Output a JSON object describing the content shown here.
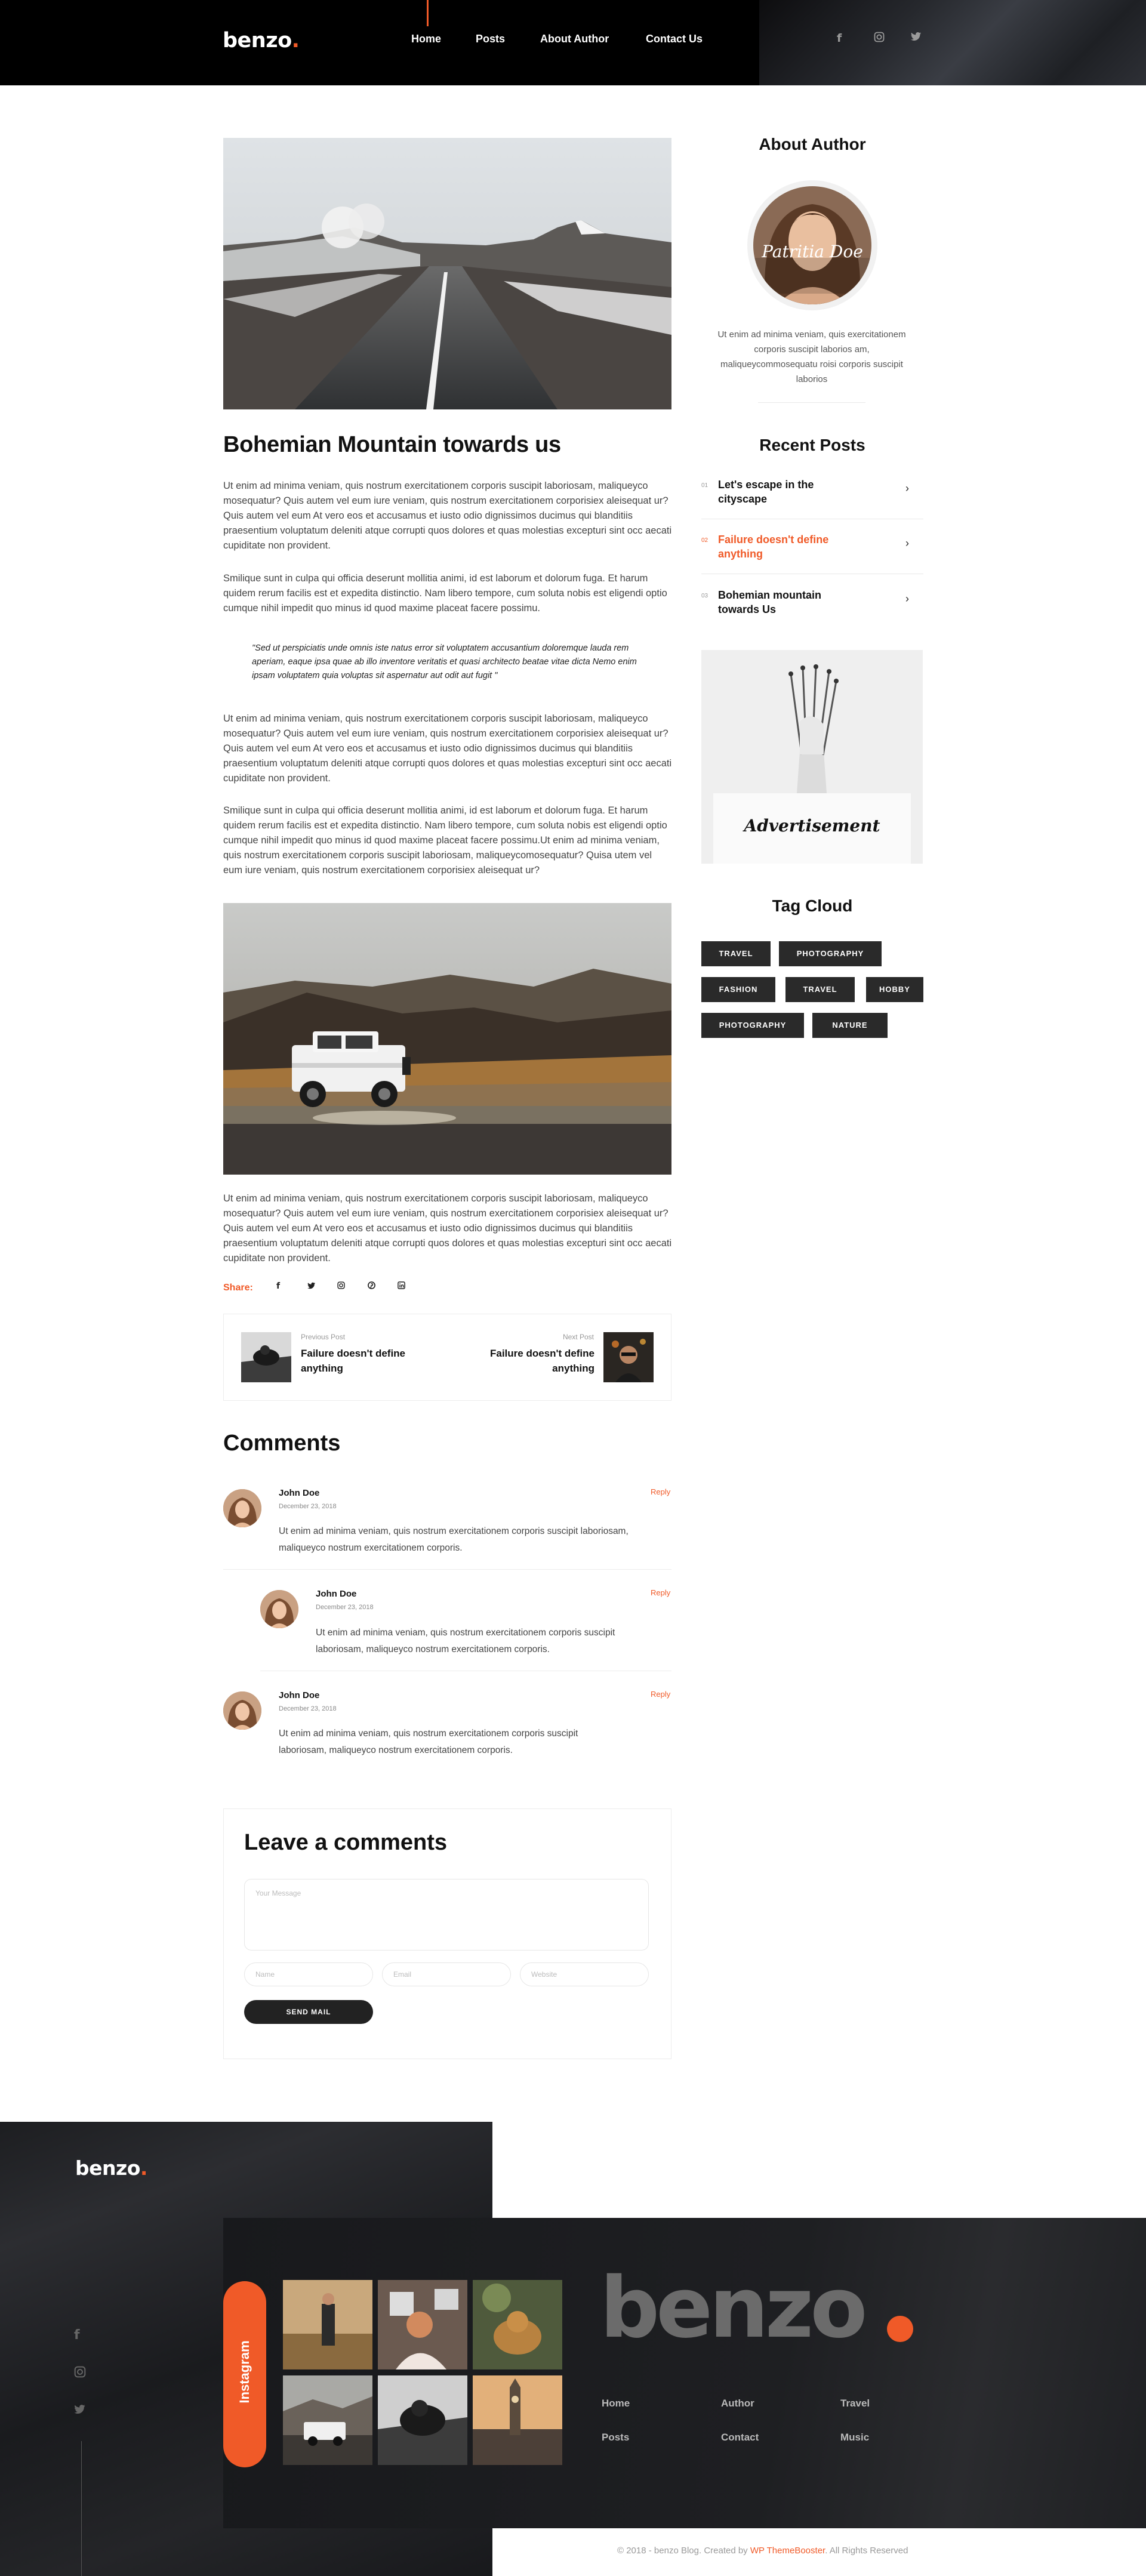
{
  "header": {
    "logo": "benzo",
    "nav": [
      "Home",
      "Posts",
      "About Author",
      "Contact Us"
    ],
    "social_icons": [
      "facebook-icon",
      "instagram-icon",
      "twitter-icon"
    ]
  },
  "post": {
    "title": "Bohemian Mountain towards us",
    "p1": "Ut enim ad minima veniam, quis nostrum exercitationem corporis suscipit laboriosam, maliqueyco mosequatur? Quis autem vel eum iure veniam, quis nostrum exercitationem corporisiex aleisequat ur? Quis autem vel eum At vero eos et accusamus et iusto odio dignissimos ducimus qui blanditiis  praesentium voluptatum deleniti atque corrupti quos dolores et quas molestias excepturi sint occ aecati cupiditate non provident.",
    "p2": "Smilique sunt in culpa qui officia deserunt mollitia animi, id est laborum et dolorum fuga. Et harum  quidem rerum facilis est et expedita distinctio. Nam libero tempore, cum soluta nobis est eligendi optio cumque nihil impedit quo minus id quod maxime placeat facere possimu.",
    "quote": "\"Sed ut perspiciatis unde omnis iste natus error sit voluptatem accusantium doloremque lauda rem aperiam, eaque ipsa quae ab illo inventore veritatis et quasi architecto beatae vitae dicta Nemo enim ipsam voluptatem quia voluptas sit aspernatur aut odit aut fugit \"",
    "p3": "Ut enim ad minima veniam, quis nostrum exercitationem corporis suscipit laboriosam, maliqueyco mosequatur? Quis autem vel eum iure veniam, quis nostrum exercitationem corporisiex aleisequat ur? Quis autem vel eum At vero eos et accusamus et iusto odio dignissimos ducimus qui blanditiis  praesentium voluptatum deleniti atque corrupti quos dolores et quas molestias excepturi sint occ aecati cupiditate non provident.",
    "p4": "Smilique sunt in culpa qui officia deserunt mollitia animi, id est laborum et dolorum fuga. Et harum  quidem rerum facilis est et expedita distinctio. Nam libero tempore, cum soluta nobis est eligendi optio cumque nihil impedit quo minus id quod maxime placeat facere possimu.Ut enim ad minima veniam, quis nostrum exercitationem corporis suscipit laboriosam, maliqueycomosequatur? Quisa utem vel eum iure veniam, quis nostrum exercitationem corporisiex aleisequat ur?",
    "p5": "Ut enim ad minima veniam, quis nostrum exercitationem corporis suscipit laboriosam, maliqueyco mosequatur? Quis autem vel eum iure veniam, quis nostrum exercitationem corporisiex aleisequat ur? Quis autem vel eum At vero eos et accusamus et iusto odio dignissimos ducimus qui blanditiis  praesentium voluptatum deleniti atque corrupti quos dolores et quas molestias excepturi sint occ aecati cupiditate non provident.",
    "share_label": "Share:",
    "share_icons": [
      "facebook-icon",
      "twitter-icon",
      "instagram-icon",
      "pinterest-icon",
      "linkedin-icon"
    ]
  },
  "post_nav": {
    "prev_label": "Previous Post",
    "prev_title": "Failure doesn't define anything",
    "next_label": "Next Post",
    "next_title": "Failure doesn't define anything"
  },
  "comments": {
    "heading": "Comments",
    "items": [
      {
        "name": "John Doe",
        "date": "December 23, 2018",
        "reply": "Reply",
        "text": "Ut enim ad minima veniam, quis nostrum exercitationem corporis suscipit laboriosam, maliqueyco nostrum exercitationem corporis."
      },
      {
        "name": "John Doe",
        "date": "December 23, 2018",
        "reply": "Reply",
        "text": "Ut enim ad minima veniam, quis nostrum exercitationem corporis suscipit laboriosam, maliqueyco nostrum exercitationem corporis."
      },
      {
        "name": "John Doe",
        "date": "December 23, 2018",
        "reply": "Reply",
        "text": "Ut enim ad minima veniam, quis nostrum exercitationem corporis suscipit laboriosam, maliqueyco nostrum exercitationem corporis."
      }
    ]
  },
  "leave": {
    "heading": "Leave a comments",
    "message_placeholder": "Your Message",
    "name_placeholder": "Name",
    "email_placeholder": "Email",
    "website_placeholder": "Website",
    "send": "SEND MAIL"
  },
  "sidebar": {
    "about_heading": "About Author",
    "author_signature": "Patritia Doe",
    "about_text": "Ut enim ad minima veniam, quis exercitationem corporis suscipit laborios am, maliqueycommosequatu roisi corporis suscipit laborios",
    "recent_heading": "Recent Posts",
    "recent": [
      {
        "num": "01",
        "title": "Let's escape in the cityscape",
        "color": "#111111"
      },
      {
        "num": "02",
        "title": "Failure doesn't define anything",
        "color": "#f05a28"
      },
      {
        "num": "03",
        "title": "Bohemian mountain towards Us",
        "color": "#111111"
      }
    ],
    "ad_text": "Advertisement",
    "tags_heading": "Tag Cloud",
    "tags": [
      "TRAVEL",
      "PHOTOGRAPHY",
      "FASHION",
      "TRAVEL",
      "HOBBY",
      "PHOTOGRAPHY",
      "NATURE"
    ]
  },
  "footer": {
    "logo": "benzo",
    "instagram_label": "Instagram",
    "big_logo": "benzo",
    "links": [
      "Home",
      "Author",
      "Travel",
      "Posts",
      "Contact",
      "Music"
    ],
    "social_icons": [
      "facebook-icon",
      "instagram-icon",
      "twitter-icon"
    ],
    "copyright_prefix": "© 2018 - benzo Blog. Created by ",
    "copyright_link": "WP ThemeBooster",
    "copyright_suffix": ". All Rights Reserved"
  },
  "colors": {
    "accent": "#f05a28",
    "dark": "#000000",
    "tag_bg": "#2a2a2a"
  }
}
